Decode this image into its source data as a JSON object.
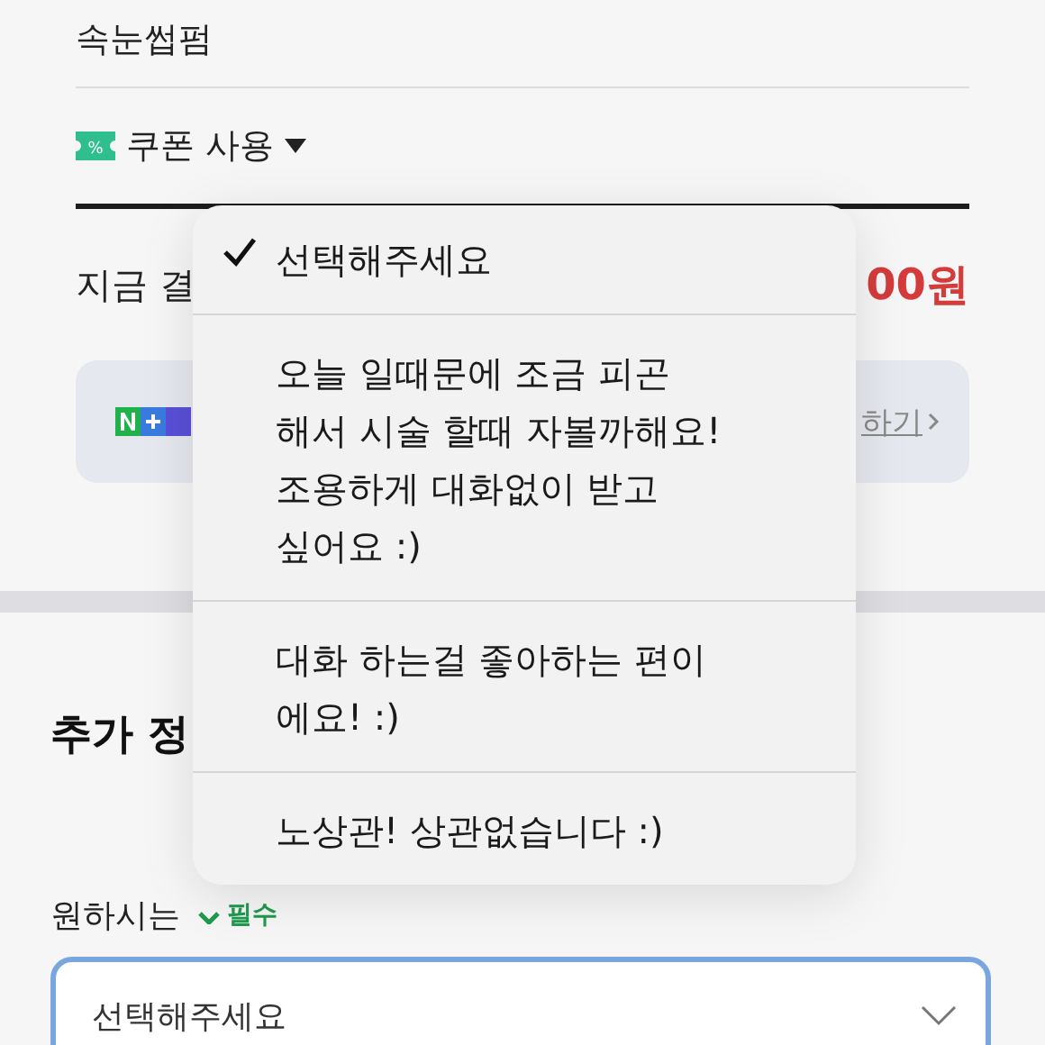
{
  "product": {
    "name": "속눈썹펌"
  },
  "coupon": {
    "badge": "%",
    "label": "쿠폰 사용"
  },
  "payment": {
    "label": "지금 결",
    "amount": "00원"
  },
  "promo": {
    "link": "하기"
  },
  "section": {
    "title": "추가 정"
  },
  "field": {
    "label": "원하시는",
    "required": "필수",
    "value": "선택해주세요"
  },
  "menu": {
    "options": [
      {
        "label": "선택해주세요",
        "selected": true
      },
      {
        "label": "오늘 일때문에 조금 피곤\n해서 시술 할때 자볼까해요!\n조용하게 대화없이 받고\n싶어요 :)",
        "selected": false
      },
      {
        "label": "대화 하는걸 좋아하는 편이\n에요! :)",
        "selected": false
      },
      {
        "label": "노상관! 상관없습니다 :)",
        "selected": false
      }
    ]
  }
}
